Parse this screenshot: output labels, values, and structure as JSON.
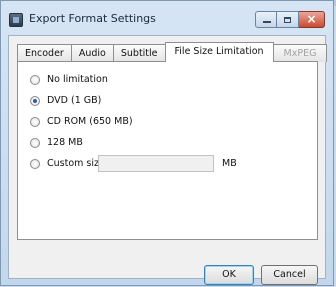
{
  "window": {
    "title": "Export Format Settings",
    "caption_buttons": {
      "minimize_glyph": "",
      "maximize_glyph": "",
      "close_glyph": "×"
    }
  },
  "tabs": [
    {
      "label": "Encoder",
      "state": "normal"
    },
    {
      "label": "Audio",
      "state": "normal"
    },
    {
      "label": "Subtitle",
      "state": "normal"
    },
    {
      "label": "File Size Limitation",
      "state": "active"
    },
    {
      "label": "MxPEG",
      "state": "disabled"
    }
  ],
  "file_size_options": [
    {
      "label": "No limitation",
      "checked": false
    },
    {
      "label": "DVD (1 GB)",
      "checked": true
    },
    {
      "label": "CD ROM (650 MB)",
      "checked": false
    },
    {
      "label": "128 MB",
      "checked": false
    },
    {
      "label": "Custom size:",
      "checked": false
    }
  ],
  "custom_size": {
    "value": "",
    "unit": "MB",
    "enabled": false
  },
  "buttons": {
    "ok": "OK",
    "cancel": "Cancel"
  },
  "colors": {
    "window_frame": "#c3d7ec",
    "close_button": "#c94a32",
    "radio_selected": "#2f5f9c"
  },
  "icons": {
    "app": "app-window-icon",
    "minimize": "minimize-icon",
    "maximize": "maximize-icon",
    "close": "close-icon"
  }
}
